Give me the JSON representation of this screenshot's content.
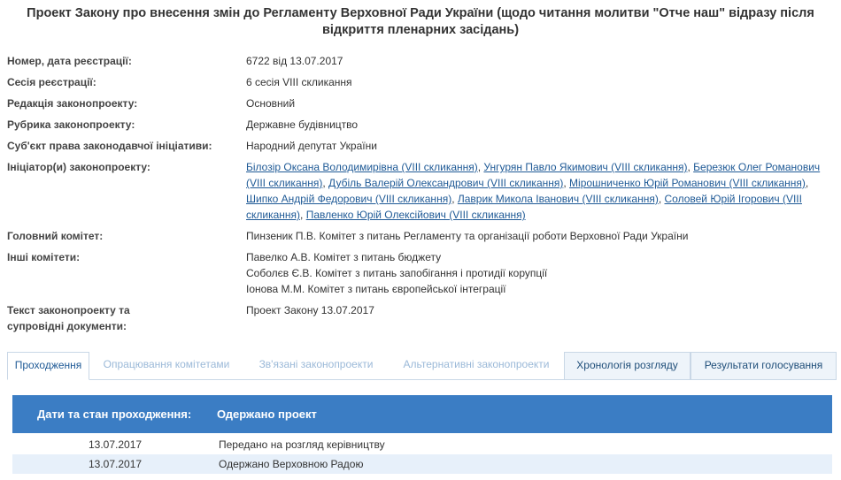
{
  "title": "Проект Закону про внесення змін до Регламенту Верховної Ради України (щодо читання молитви \"Отче наш\" відразу після відкриття пленарних засідань)",
  "fields": {
    "reg_label": "Номер, дата реєстрації:",
    "reg_value": "6722 від 13.07.2017",
    "session_label": "Сесія реєстрації:",
    "session_value": "6 сесія VIII скликання",
    "edition_label": "Редакція законопроекту:",
    "edition_value": "Основний",
    "rubric_label": "Рубрика законопроекту:",
    "rubric_value": "Державне будівництво",
    "subject_label": "Суб'єкт права законодавчої ініціативи:",
    "subject_value": "Народний депутат України",
    "initiators_label": "Ініціатор(и) законопроекту:",
    "main_committee_label": "Головний комітет:",
    "main_committee_value": "Пинзеник П.В. Комітет з питань Регламенту та організації роботи Верховної Ради України",
    "other_committees_label": "Інші комітети:",
    "text_label": "Текст законопроекту та супровідні документи:",
    "text_value": "Проект Закону 13.07.2017"
  },
  "initiators": [
    "Білозір Оксана Володимирівна (VIII скликання)",
    "Унгурян Павло Якимович (VIII скликання)",
    "Березюк Олег Романович (VIII скликання)",
    "Дубіль Валерій Олександрович (VIII скликання)",
    "Мірошниченко Юрій Романович (VIII скликання)",
    "Шипко Андрій Федорович (VIII скликання)",
    "Лаврик Микола Іванович (VIII скликання)",
    "Соловей Юрій Ігорович (VIII скликання)",
    "Павленко Юрій Олексійович (VIII скликання)"
  ],
  "other_committees": [
    "Павелко А.В. Комітет з питань бюджету",
    "Соболєв Є.В. Комітет з питань запобігання і протидії корупції",
    "Іонова М.М. Комітет з питань європейської інтеграції"
  ],
  "tabs": [
    {
      "label": "Проходження"
    },
    {
      "label": "Опрацювання комітетами"
    },
    {
      "label": "Зв'язані законопроекти"
    },
    {
      "label": "Альтернативні законопроекти"
    },
    {
      "label": "Хронологія розгляду"
    },
    {
      "label": "Результати голосування"
    }
  ],
  "table": {
    "col1_header": "Дати та стан проходження:",
    "col2_header": "Одержано проект",
    "rows": [
      {
        "date": "13.07.2017",
        "event": "Передано на розгляд керівництву"
      },
      {
        "date": "13.07.2017",
        "event": "Одержано Верховною Радою"
      }
    ]
  },
  "colors": {
    "link": "#1f5a96",
    "table_header_bg": "#3b7dc4",
    "row_alt_bg": "#e7f0fa"
  }
}
